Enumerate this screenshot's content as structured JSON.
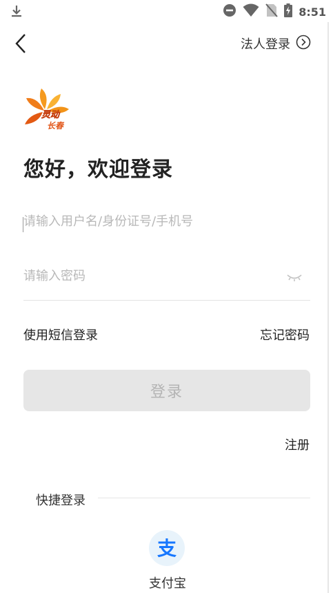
{
  "status_bar": {
    "time": "8:51",
    "icons": [
      "download-icon",
      "do-not-disturb-icon",
      "wifi-icon",
      "no-sim-icon",
      "battery-charging-icon"
    ]
  },
  "header": {
    "back_icon": "chevron-left-icon",
    "corp_login_label": "法人登录",
    "corp_login_icon": "circle-chevron-right-icon"
  },
  "logo": {
    "text_top": "灵动",
    "text_bottom": "长春"
  },
  "welcome_title": "您好，欢迎登录",
  "form": {
    "username_placeholder": "请输入用户名/身份证号/手机号",
    "password_placeholder": "请输入密码",
    "password_toggle_icon": "eye-closed-icon",
    "sms_login_label": "使用短信登录",
    "forgot_password_label": "忘记密码",
    "login_button_label": "登录",
    "register_label": "注册"
  },
  "quick_login": {
    "label": "快捷登录",
    "providers": [
      {
        "label": "支付宝",
        "icon": "alipay-icon",
        "glyph": "支"
      }
    ]
  },
  "colors": {
    "alipay_blue": "#1677ff",
    "logo_orange": "#f07d1a",
    "button_disabled_bg": "#e6e6e6"
  }
}
